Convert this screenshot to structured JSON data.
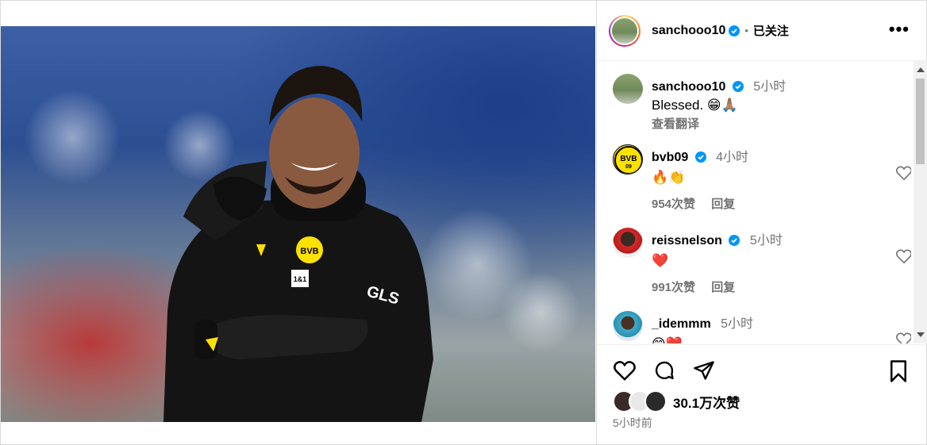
{
  "header": {
    "username": "sanchooo10",
    "separator": "•",
    "follow_status": "已关注",
    "more_label": "•••"
  },
  "caption": {
    "username": "sanchooo10",
    "time": "5小时",
    "text": "Blessed. 😁🙏🏽",
    "translate": "查看翻译"
  },
  "comments": [
    {
      "username": "bvb09",
      "time": "4小时",
      "text": "🔥👏",
      "likes": "954次赞",
      "reply": "回复"
    },
    {
      "username": "reissnelson",
      "time": "5小时",
      "text": "❤️",
      "likes": "991次赞",
      "reply": "回复"
    },
    {
      "username": "_idemmm",
      "time": "5小时",
      "text": "😁❤️"
    }
  ],
  "footer": {
    "likes": "30.1万次赞",
    "post_time": "5小时前"
  },
  "colors": {
    "verified": "#0095f6",
    "muted": "#737373",
    "bvb_yellow": "#fde100"
  },
  "icons": [
    "verified-icon",
    "more-options-icon",
    "heart-icon",
    "comment-icon",
    "share-icon",
    "bookmark-icon"
  ]
}
